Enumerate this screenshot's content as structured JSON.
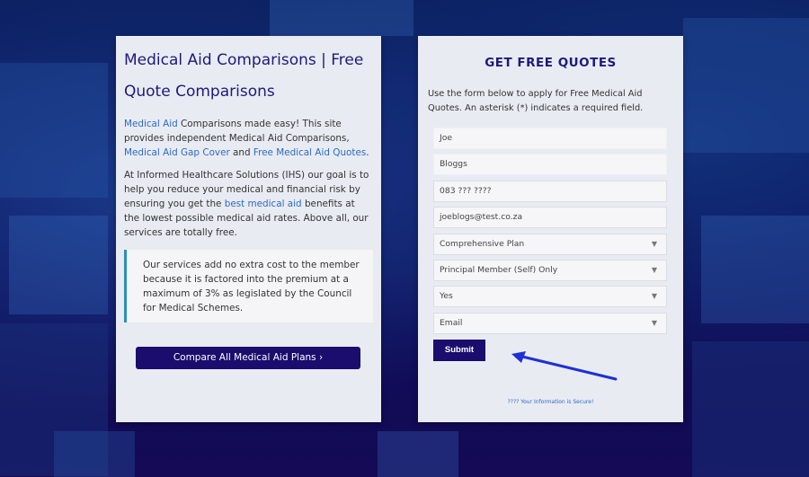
{
  "left": {
    "title": "Medical Aid Comparisons | Free Quote Comparisons",
    "p1": {
      "link1": "Medical Aid",
      "text1": " Comparisons made easy! This site provides independent Medical Aid Comparisons, ",
      "link2": "Medical Aid Gap Cover",
      "text2": " and ",
      "link3": "Free Medical Aid Quotes",
      "text3": "."
    },
    "p2": {
      "text1": "At Informed Healthcare Solutions (IHS) our goal is to help you reduce your medical and financial risk by ensuring you get the ",
      "link1": "best medical aid",
      "text2": " benefits at the lowest possible medical aid rates. Above all, our services are totally free."
    },
    "quote": "Our services add no extra cost to the member because it is factored into the premium at a maximum of 3% as legislated by the Council for Medical Schemes.",
    "compare_button": "Compare All Medical Aid Plans ›"
  },
  "right": {
    "title": "GET FREE QUOTES",
    "intro": "Use the form below to apply for Free Medical Aid Quotes. An asterisk (*) indicates a required field.",
    "fields": {
      "first_name": "Joe",
      "last_name": "Bloggs",
      "phone": "083 ??? ????",
      "email": "joeblogs@test.co.za",
      "plan_type": "Comprehensive Plan",
      "membership": "Principal Member (Self) Only",
      "yes_no": "Yes",
      "contact_method": "Email"
    },
    "submit_label": "Submit",
    "secure_text": "???? Your Information is Secure!"
  },
  "colors": {
    "accent": "#1a0d6e",
    "link": "#2a6bc4",
    "arrow": "#1f2fd6"
  }
}
